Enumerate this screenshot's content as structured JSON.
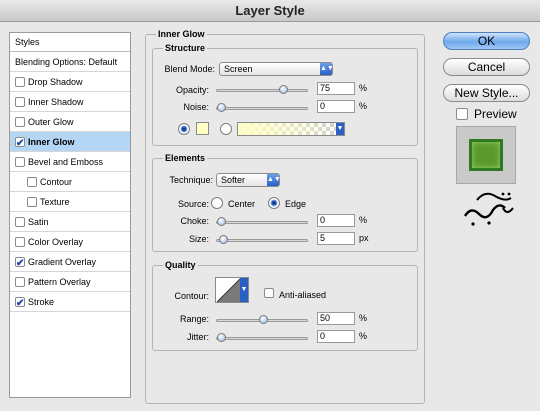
{
  "window": {
    "title": "Layer Style"
  },
  "sidebar": {
    "header": "Styles",
    "blending": "Blending Options: Default",
    "items": [
      {
        "label": "Drop Shadow",
        "checked": false,
        "selected": false,
        "sub": false
      },
      {
        "label": "Inner Shadow",
        "checked": false,
        "selected": false,
        "sub": false
      },
      {
        "label": "Outer Glow",
        "checked": false,
        "selected": false,
        "sub": false
      },
      {
        "label": "Inner Glow",
        "checked": true,
        "selected": true,
        "sub": false
      },
      {
        "label": "Bevel and Emboss",
        "checked": false,
        "selected": false,
        "sub": false
      },
      {
        "label": "Contour",
        "checked": false,
        "selected": false,
        "sub": true
      },
      {
        "label": "Texture",
        "checked": false,
        "selected": false,
        "sub": true
      },
      {
        "label": "Satin",
        "checked": false,
        "selected": false,
        "sub": false
      },
      {
        "label": "Color Overlay",
        "checked": false,
        "selected": false,
        "sub": false
      },
      {
        "label": "Gradient Overlay",
        "checked": true,
        "selected": false,
        "sub": false
      },
      {
        "label": "Pattern Overlay",
        "checked": false,
        "selected": false,
        "sub": false
      },
      {
        "label": "Stroke",
        "checked": true,
        "selected": false,
        "sub": false
      }
    ]
  },
  "panel": {
    "title": "Inner Glow",
    "structure": {
      "label": "Structure",
      "blend_mode_label": "Blend Mode:",
      "blend_mode_value": "Screen",
      "opacity_label": "Opacity:",
      "opacity_value": "75",
      "opacity_fraction": 0.75,
      "noise_label": "Noise:",
      "noise_value": "0",
      "noise_fraction": 0,
      "percent": "%",
      "color_radio_selected": true,
      "glow_color": "#ffffc6",
      "gradient_start": "#ffffc6"
    },
    "elements": {
      "label": "Elements",
      "technique_label": "Technique:",
      "technique_value": "Softer",
      "source_label": "Source:",
      "source_center": "Center",
      "source_edge": "Edge",
      "source_selected": "Edge",
      "choke_label": "Choke:",
      "choke_value": "0",
      "choke_fraction": 0,
      "size_label": "Size:",
      "size_value": "5",
      "size_fraction": 0.02,
      "percent": "%",
      "px": "px"
    },
    "quality": {
      "label": "Quality",
      "contour_label": "Contour:",
      "anti_aliased_label": "Anti-aliased",
      "anti_aliased": false,
      "range_label": "Range:",
      "range_value": "50",
      "range_fraction": 0.5,
      "jitter_label": "Jitter:",
      "jitter_value": "0",
      "jitter_fraction": 0,
      "percent": "%"
    }
  },
  "actions": {
    "ok": "OK",
    "cancel": "Cancel",
    "new_style": "New Style...",
    "preview_label": "Preview",
    "preview_checked": false,
    "preview_color": "#5a9a2c"
  },
  "colors": {
    "selection": "#b5d5f5",
    "accent": "#2a5fc4"
  }
}
